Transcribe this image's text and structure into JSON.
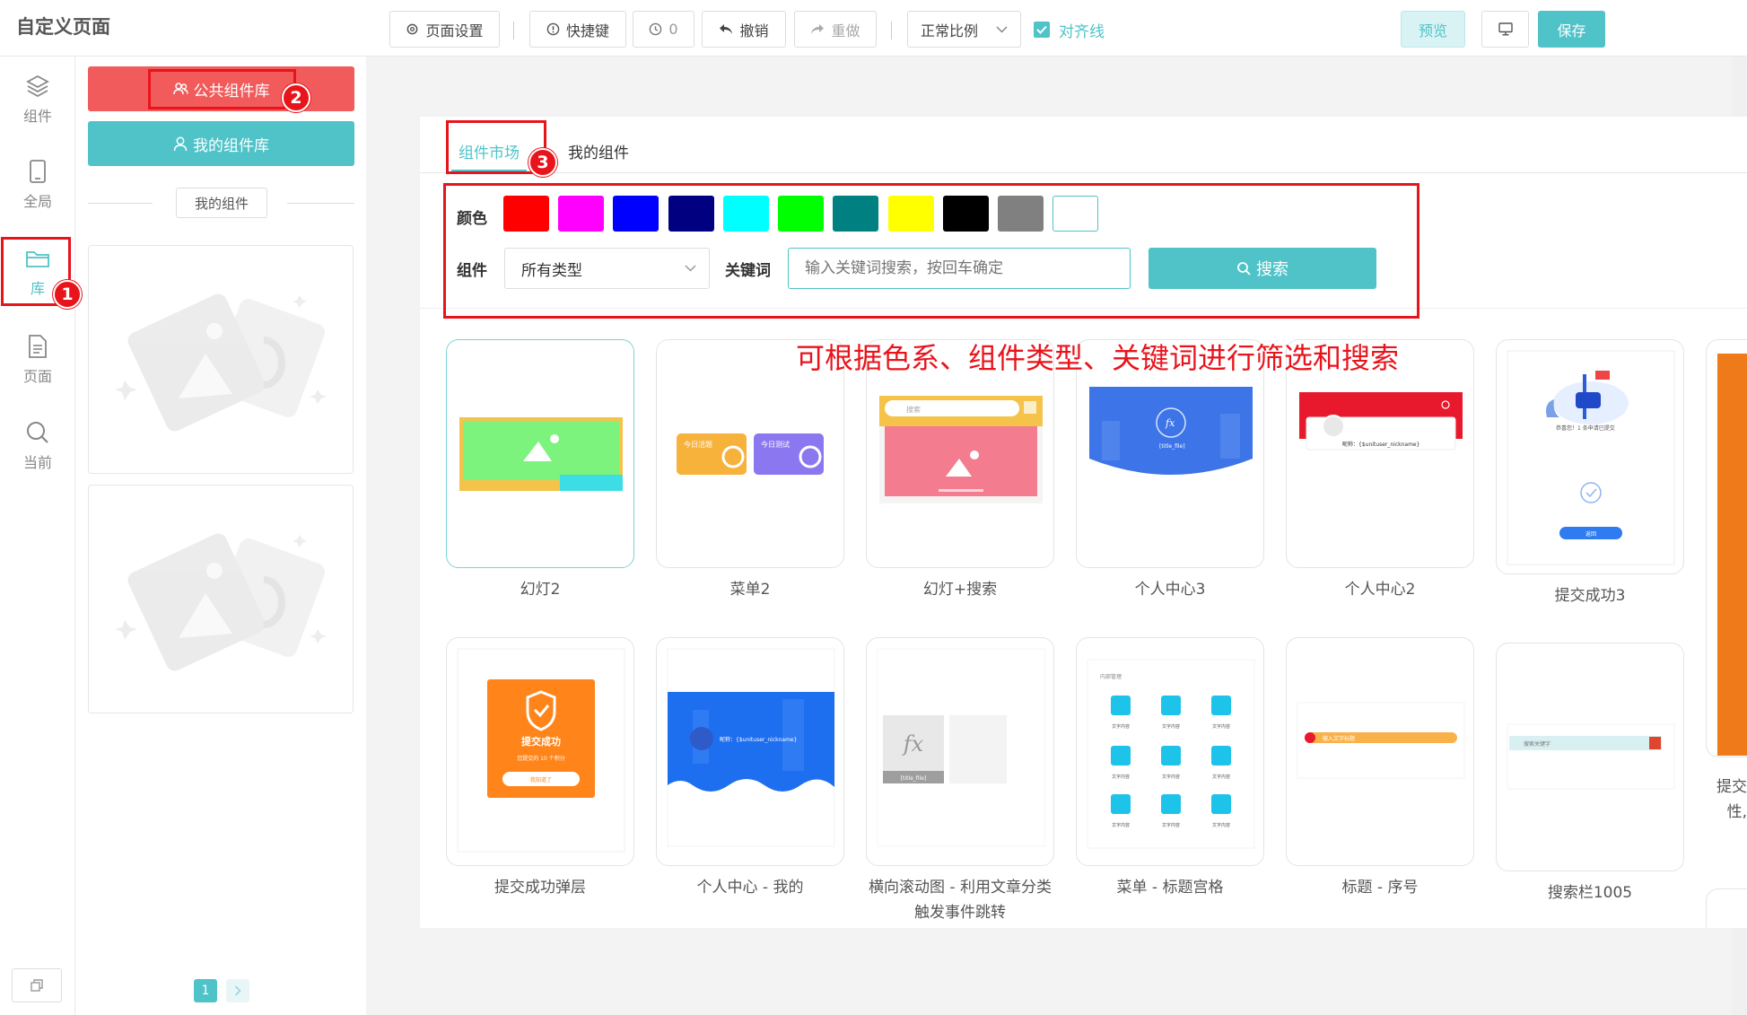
{
  "app": {
    "title": "自定义页面"
  },
  "toolbar": {
    "page_settings": "页面设置",
    "shortcuts": "快捷键",
    "history_count": "0",
    "undo": "撤销",
    "redo": "重做",
    "scale": "正常比例",
    "align_lines": "对齐线",
    "preview": "预览",
    "save": "保存"
  },
  "rail": {
    "items": [
      {
        "label": "组件",
        "icon": "layers-icon"
      },
      {
        "label": "全局",
        "icon": "tablet-icon"
      },
      {
        "label": "库",
        "icon": "folder-icon"
      },
      {
        "label": "页面",
        "icon": "document-icon"
      },
      {
        "label": "当前",
        "icon": "search-icon"
      }
    ]
  },
  "library": {
    "public_button": "公共组件库",
    "mine_button": "我的组件库",
    "section_label": "我的组件",
    "page": "1"
  },
  "market": {
    "tabs": [
      "组件市场",
      "我的组件"
    ],
    "color_label": "颜色",
    "colors": [
      "#ff0000",
      "#ff00ff",
      "#0000ff",
      "#000080",
      "#00ffff",
      "#00ff00",
      "#008080",
      "#ffff00",
      "#000000",
      "#808080",
      "#ffffff"
    ],
    "type_label": "组件",
    "type_value": "所有类型",
    "keyword_label": "关键词",
    "keyword_placeholder": "输入关键词搜索，按回车确定",
    "search_button": "搜索",
    "components": [
      {
        "name": "幻灯2"
      },
      {
        "name": "菜单2"
      },
      {
        "name": "幻灯+搜索"
      },
      {
        "name": "个人中心3"
      },
      {
        "name": "个人中心2"
      },
      {
        "name": "提交成功3"
      },
      {
        "name": "提交成功弹层"
      },
      {
        "name": "个人中心 - 我的"
      },
      {
        "name": "横向滚动图 - 利用文章分类触发事件跳转"
      },
      {
        "name": "菜单 - 标题宫格"
      },
      {
        "name": "标题 - 序号"
      },
      {
        "name": "搜索栏1005"
      }
    ],
    "partial_text": "提交 性,"
  },
  "annotations": {
    "badges": [
      "1",
      "2",
      "3"
    ],
    "caption": "可根据色系、组件类型、关键词进行筛选和搜索"
  },
  "thumbs": {
    "menu_a": "今日活题",
    "menu_b": "今日测试",
    "search_ph": "搜索",
    "fx": "fx",
    "fx_sub": "[title_file]",
    "nick": "昵称：{$unituser_nickname}",
    "success_title": "提交成功",
    "success_sub": "您提交的 10 个积分",
    "success_btn": "我知道了",
    "grid_title": "内部管理",
    "grid_item": "文字内容",
    "title_bar": "输入文字标题",
    "search_bar": "搜索关键字",
    "submit_text": "恭喜您！1 条申请已提交",
    "submit_btn": "返回"
  },
  "colors": {
    "accent": "#4fc3c8",
    "danger": "#f25b5b",
    "annotation": "#e8141c"
  }
}
